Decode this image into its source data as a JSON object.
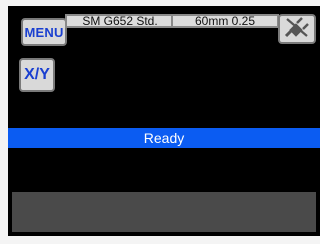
{
  "header": {
    "menu_label": "MENU",
    "fiber_type": "SM G652 Std.",
    "cleave_length": "60mm 0.25",
    "power_icon": "plug-icon"
  },
  "controls": {
    "xy_label": "X/Y"
  },
  "status": {
    "text": "Ready",
    "color": "#0b5cf2"
  },
  "colors": {
    "button_text": "#1a3fd0",
    "message_bar": "#4a4a4a"
  }
}
